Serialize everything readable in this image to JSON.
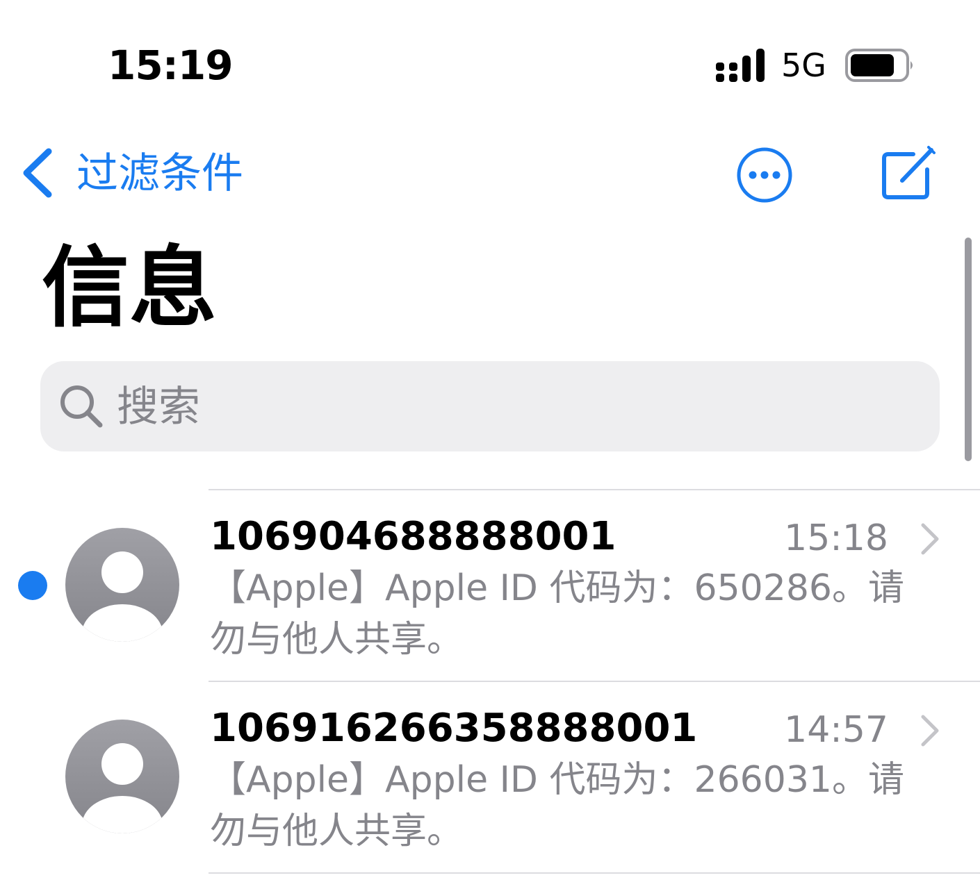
{
  "status_bar": {
    "time": "15:19",
    "network": "5G",
    "icons": [
      "signal-icon",
      "battery-icon"
    ]
  },
  "nav": {
    "back_label": "过滤条件",
    "icons": [
      "back-chevron-icon",
      "more-icon",
      "compose-icon"
    ]
  },
  "title": "信息",
  "search": {
    "placeholder": "搜索"
  },
  "messages": [
    {
      "sender": "106904688888001",
      "time": "15:18",
      "preview": "【Apple】Apple ID 代码为：650286。请勿与他人共享。",
      "unread": true
    },
    {
      "sender": "106916266358888001",
      "time": "14:57",
      "preview": "【Apple】Apple ID 代码为：266031。请勿与他人共享。",
      "unread": false
    }
  ],
  "colors": {
    "accent": "#1a7cf0",
    "secondary_text": "#85858b",
    "search_bg": "#eeeef0",
    "avatar": "#8e8e93"
  }
}
